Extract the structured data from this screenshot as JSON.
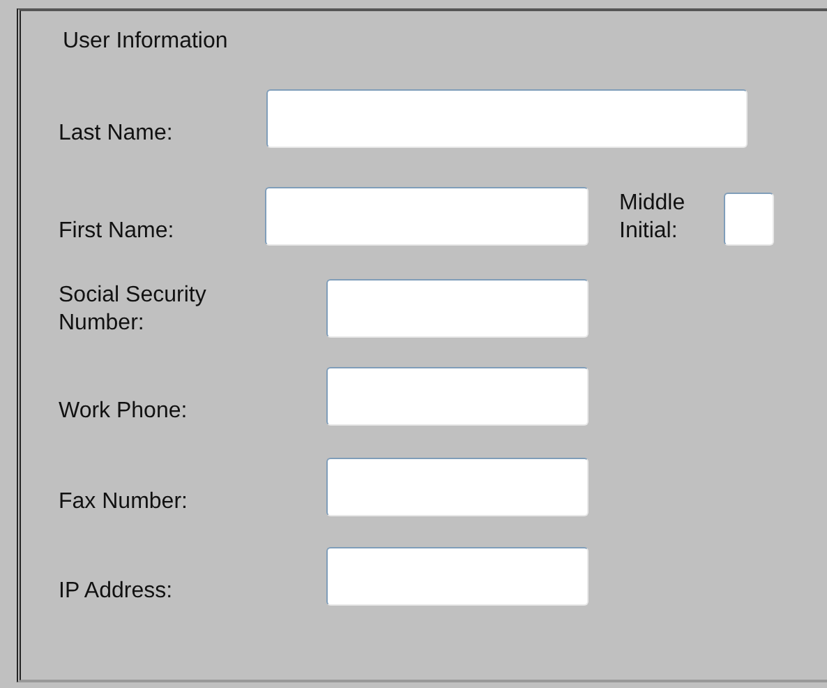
{
  "panel": {
    "title": "User Information"
  },
  "rows": [
    {
      "fields": [
        {
          "label": "Last Name:",
          "kind": "long"
        }
      ]
    },
    {
      "fields": [
        {
          "label": "First Name:",
          "kind": "medium"
        },
        {
          "label": "Middle\nInitial:",
          "kind": "initial"
        }
      ]
    },
    {
      "fields": [
        {
          "label": "Social Security\nNumber:",
          "kind": "short"
        }
      ]
    },
    {
      "fields": [
        {
          "label": "Work Phone:",
          "kind": "short"
        }
      ]
    },
    {
      "fields": [
        {
          "label": "Fax Number:",
          "kind": "short"
        }
      ]
    },
    {
      "fields": [
        {
          "label": "IP Address:",
          "kind": "short"
        }
      ]
    }
  ]
}
